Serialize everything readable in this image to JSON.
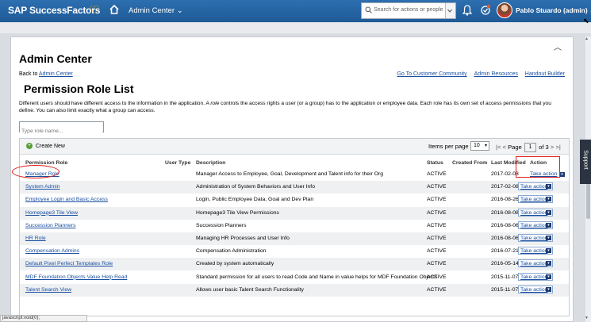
{
  "header": {
    "brand": "SAP SuccessFactors",
    "module": "Admin Center",
    "search_placeholder": "Search for actions or people",
    "user": "Pablo Stuardo (admin)"
  },
  "page": {
    "title": "Admin Center",
    "back_prefix": "Back to",
    "back_link": "Admin Center",
    "links": [
      "Go To Customer Community",
      "Admin Resources",
      "Handout Builder"
    ],
    "section_title": "Permission Role List",
    "description_pre": "Different users should have different access to the information in the application. A ",
    "description_em": "role",
    "description_post": " controls the access rights a user (or a group) has to the application or employee data. Each role has its own set of access permissions that you define. You can also limit exactly what a group can access.",
    "filter_placeholder": "Type role name..."
  },
  "grid": {
    "create_label": "Create New",
    "items_per_page_label": "Items per page",
    "items_per_page": "10",
    "page_label": "Page",
    "page_value": "1",
    "page_of": "of 3",
    "columns": [
      "Permission Role",
      "User Type",
      "Description",
      "Status",
      "Created From",
      "Last Modified",
      "Action"
    ],
    "rows": [
      {
        "role": "Manager Role",
        "desc": "Manager Access to Employee, Goal, Development and Talent info for their Org",
        "status": "ACTIVE",
        "modified": "2017-02-08",
        "action": "Take action"
      },
      {
        "role": "System Admin",
        "desc": "Administration of System Behaviors and User Info",
        "status": "ACTIVE",
        "modified": "2017-02-08",
        "action": "Take action"
      },
      {
        "role": "Employee Login and Basic Access",
        "desc": "Login, Public Employee Data, Goal and Dev Plan",
        "status": "ACTIVE",
        "modified": "2016-08-26",
        "action": "Take action"
      },
      {
        "role": "Homepage3 Tile View",
        "desc": "Homepage3 Tile View Permissions",
        "status": "ACTIVE",
        "modified": "2016-08-08",
        "action": "Take action"
      },
      {
        "role": "Succession Planners",
        "desc": "Succession Planners",
        "status": "ACTIVE",
        "modified": "2016-08-06",
        "action": "Take action"
      },
      {
        "role": "HR Role",
        "desc": "Managing HR Processes and User Info",
        "status": "ACTIVE",
        "modified": "2016-08-06",
        "action": "Take action"
      },
      {
        "role": "Compensation Admins",
        "desc": "Compensation Administration",
        "status": "ACTIVE",
        "modified": "2016-07-21",
        "action": "Take action"
      },
      {
        "role": "Default Pixel Perfect Templates Role",
        "desc": "Created by system automatically",
        "status": "ACTIVE",
        "modified": "2016-05-14",
        "action": "Take action"
      },
      {
        "role": "MDF Foundation Objects Value Help Read",
        "desc": "Standard permission for all users to read Code and Name in value helps for MDF Foundation Objects",
        "status": "ACTIVE",
        "modified": "2015-11-07",
        "action": "Take action"
      },
      {
        "role": "Talent Search View",
        "desc": "Allows user basic Talent Search Functionality",
        "status": "ACTIVE",
        "modified": "2015-11-07",
        "action": "Take action"
      }
    ]
  },
  "support_label": "Support",
  "status_bar": "javascript:void(0);",
  "colors": {
    "topbar": "#1f5a96",
    "accent": "#f0ab00",
    "link": "#1a4fa0",
    "highlight": "#e02020"
  }
}
